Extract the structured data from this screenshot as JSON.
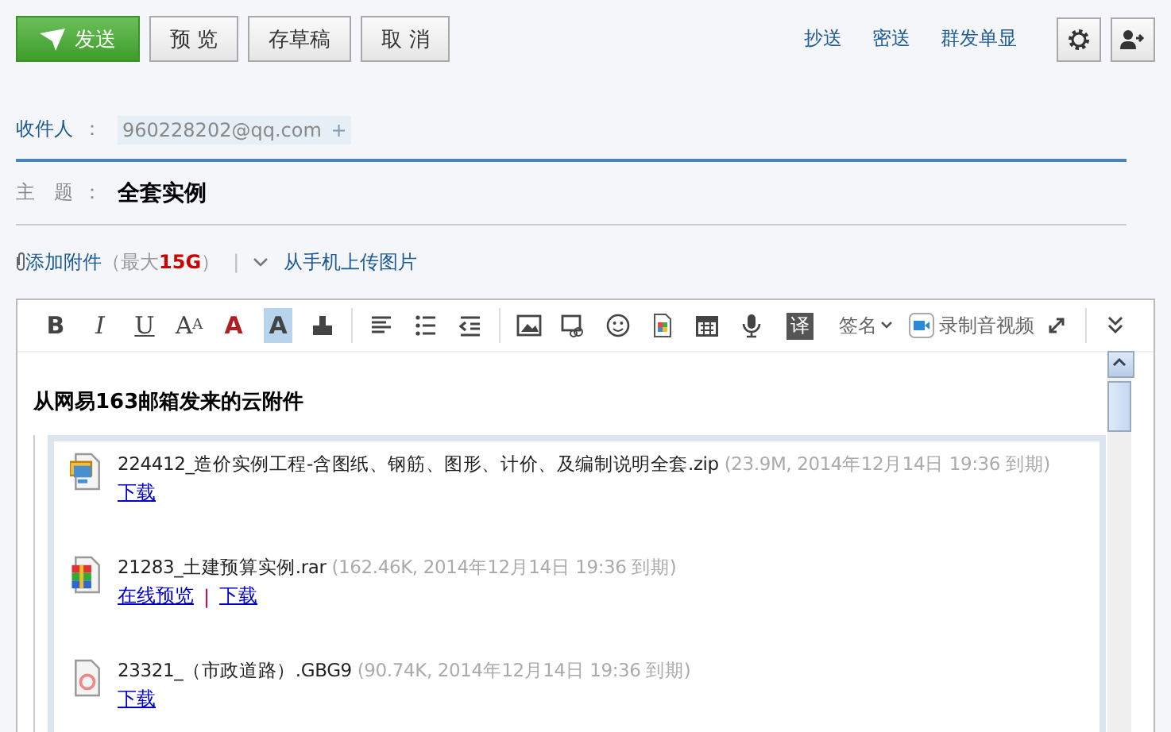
{
  "top_buttons": [
    {
      "label": "发送",
      "kind": "primary"
    },
    {
      "label": "预 览",
      "kind": "normal"
    },
    {
      "label": "存草稿",
      "kind": "normal"
    },
    {
      "label": "取 消",
      "kind": "normal"
    }
  ],
  "top_links": [
    "抄送",
    "密送",
    "群发单显"
  ],
  "recipients": {
    "label": "收件人",
    "colon": "：",
    "items": [
      {
        "address": "960228202@qq.com",
        "add": "+"
      }
    ]
  },
  "subject": {
    "label": "主　题",
    "colon": "：",
    "value": "全套实例"
  },
  "attach": {
    "add_label": "添加附件",
    "limit_open": "（最大",
    "limit_value": "15G",
    "limit_close": "）",
    "divider": "|",
    "mobile_upload": "从手机上传图片"
  },
  "toolbar": {
    "format_buttons": [
      {
        "text": "B"
      },
      {
        "text": "I"
      },
      {
        "text": "U"
      },
      {
        "text": "A$^{A}$"
      },
      {
        "text": "A"
      },
      {
        "text": "A"
      }
    ],
    "translate": "译",
    "signature": "签名",
    "record": "录制音视频"
  },
  "body": {
    "heading": "从网易163邮箱发来的云附件",
    "link_separator": "|",
    "files": [
      {
        "kind": "exe",
        "name": "224412_造价实例工程-含图纸、钢筋、图形、计价、及编制说明全套.zip",
        "meta": "(23.9M, 2014年12月14日 19:36 到期)",
        "links": [
          "下载"
        ]
      },
      {
        "kind": "rar",
        "name": "21283_土建预算实例.rar",
        "meta": "(162.46K, 2014年12月14日  19:36 到期)",
        "links": [
          "在线预览",
          "下载"
        ]
      },
      {
        "kind": "doc",
        "name": "23321_（市政道路）.GBG9",
        "meta": "(90.74K, 2014年12月14日  19:36 到期)",
        "links": [
          "下载"
        ]
      }
    ]
  }
}
